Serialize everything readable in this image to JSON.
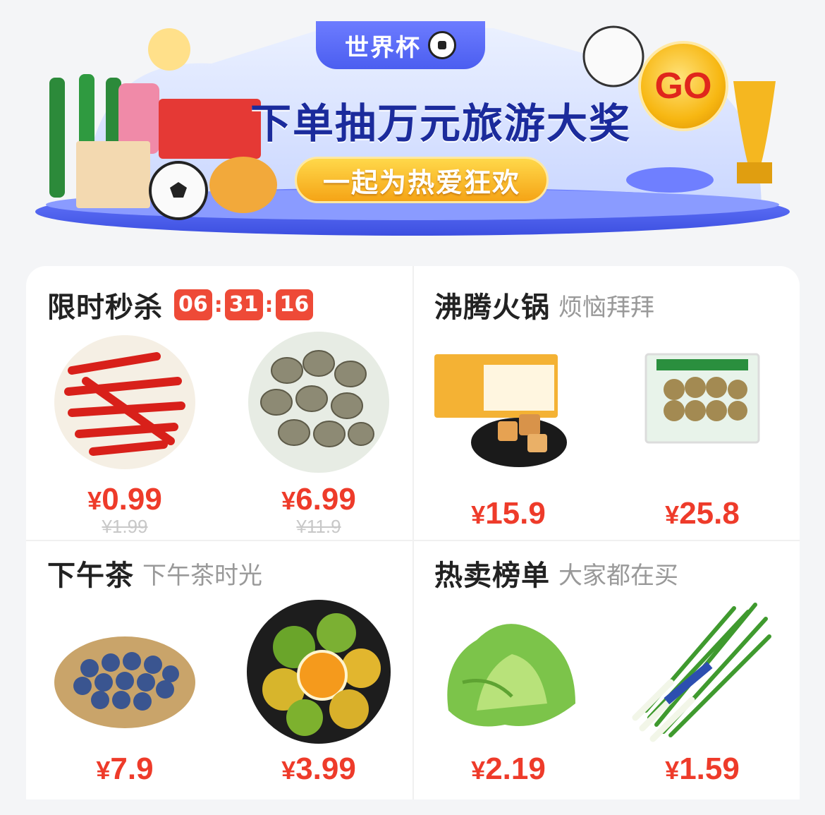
{
  "banner": {
    "tag": "世界杯",
    "headline": "下单抽万元旅游大奖",
    "subline": "一起为热爱狂欢",
    "go_label": "GO",
    "colors": {
      "primary": "#1b2b9c",
      "accent": "#f7b712",
      "sale": "#ee3b2a"
    }
  },
  "sections": [
    {
      "title": "限时秒杀",
      "timer": {
        "hours": "06",
        "minutes": "31",
        "seconds": "16"
      },
      "products": [
        {
          "name": "red-chili",
          "price": "0.99",
          "old_price": "¥1.99"
        },
        {
          "name": "clams",
          "price": "6.99",
          "old_price": "¥11.9"
        }
      ]
    },
    {
      "title": "沸腾火锅",
      "subtitle": "烦恼拜拜",
      "products": [
        {
          "name": "fish-tofu",
          "price": "15.9"
        },
        {
          "name": "beef-balls",
          "price": "25.8"
        }
      ]
    },
    {
      "title": "下午茶",
      "subtitle": "下午茶时光",
      "products": [
        {
          "name": "blueberries",
          "price": "7.9"
        },
        {
          "name": "oranges",
          "price": "3.99"
        }
      ]
    },
    {
      "title": "热卖榜单",
      "subtitle": "大家都在买",
      "products": [
        {
          "name": "lettuce",
          "price": "2.19"
        },
        {
          "name": "scallions",
          "price": "1.59"
        }
      ]
    }
  ],
  "currency": "¥"
}
